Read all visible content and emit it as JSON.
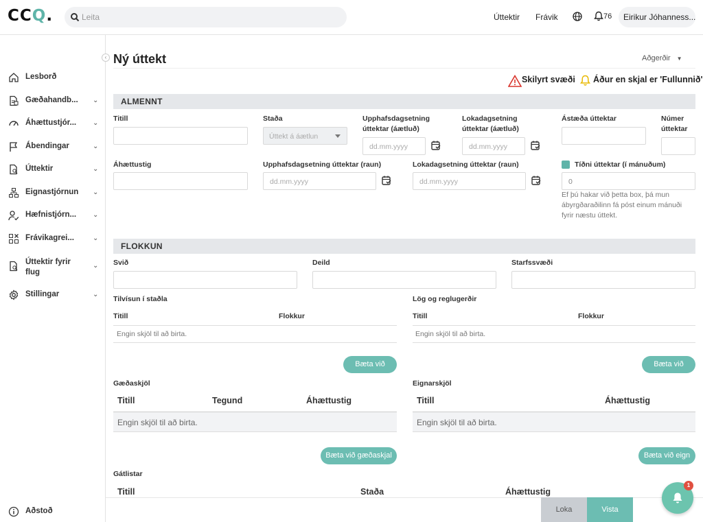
{
  "header": {
    "search_placeholder": "Leita",
    "nav_audits": "Úttektir",
    "nav_deviations": "Frávik",
    "notification_count": "76",
    "user_name": "Eirikur Jóhanness..."
  },
  "sidebar": {
    "items": [
      {
        "label": "Lesborð",
        "icon": "home-icon"
      },
      {
        "label": "Gæðahandb...",
        "icon": "document-list-icon"
      },
      {
        "label": "Áhættustjór...",
        "icon": "gauge-icon"
      },
      {
        "label": "Ábendingar",
        "icon": "flag-icon"
      },
      {
        "label": "Úttektir",
        "icon": "document-search-icon"
      },
      {
        "label": "Eignastjórnun",
        "icon": "hierarchy-icon"
      },
      {
        "label": "Hæfnistjórn...",
        "icon": "user-check-icon"
      },
      {
        "label": "Frávikagrei...",
        "icon": "grid-x-icon"
      },
      {
        "label": "Úttektir fyrir flug",
        "icon": "document-search-icon"
      },
      {
        "label": "Stillingar",
        "icon": "gear-icon"
      }
    ],
    "help_label": "Aðstoð"
  },
  "page": {
    "title": "Ný úttekt",
    "actions_label": "Aðgerðir",
    "required_legend": "Skilyrt svæði",
    "before_final_legend": "Áður en skjal er 'Fullunnið'"
  },
  "general": {
    "heading": "ALMENNT",
    "title_label": "Titill",
    "status_label": "Staða",
    "status_value": "Úttekt á áætlun",
    "planned_start_label": "Upphafsdagsetning úttektar (áætluð)",
    "planned_end_label": "Lokadagsetning úttektar (áætluð)",
    "reason_label": "Ástæða úttektar",
    "number_label": "Númer úttektar",
    "risk_label": "Áhættustig",
    "actual_start_label": "Upphafsdagsetning úttektar (raun)",
    "actual_end_label": "Lokadagsetning úttektar (raun)",
    "frequency_label": "Tíðni úttektar (í mánuðum)",
    "frequency_value": "0",
    "date_placeholder": "dd.mm.yyyy",
    "frequency_help": "Ef þú hakar við þetta box, þá mun ábyrgðaraðilinn fá póst einum mánuði fyrir næstu úttekt."
  },
  "classification": {
    "heading": "FLOKKUN",
    "domain_label": "Svið",
    "department_label": "Deild",
    "area_label": "Starfssvæði",
    "standards_ref_label": "Tilvísun í staðla",
    "laws_label": "Lög og reglugerðir",
    "col_title": "Titill",
    "col_category": "Flokkur",
    "col_type": "Tegund",
    "col_risk": "Áhættustig",
    "col_status": "Staða",
    "empty_text": "Engin skjöl til að birta.",
    "add_button": "Bæta við",
    "quality_docs_label": "Gæðaskjöl",
    "asset_docs_label": "Eignarskjöl",
    "add_quality_button": "Bæta við gæðaskjal",
    "add_asset_button": "Bæta við eign",
    "checklists_label": "Gátlistar"
  },
  "footer": {
    "close_label": "Loka",
    "save_label": "Vista",
    "fab_badge": "1"
  },
  "colors": {
    "accent": "#6cbdb2",
    "warning": "#d9342b",
    "bell": "#e8b800"
  }
}
